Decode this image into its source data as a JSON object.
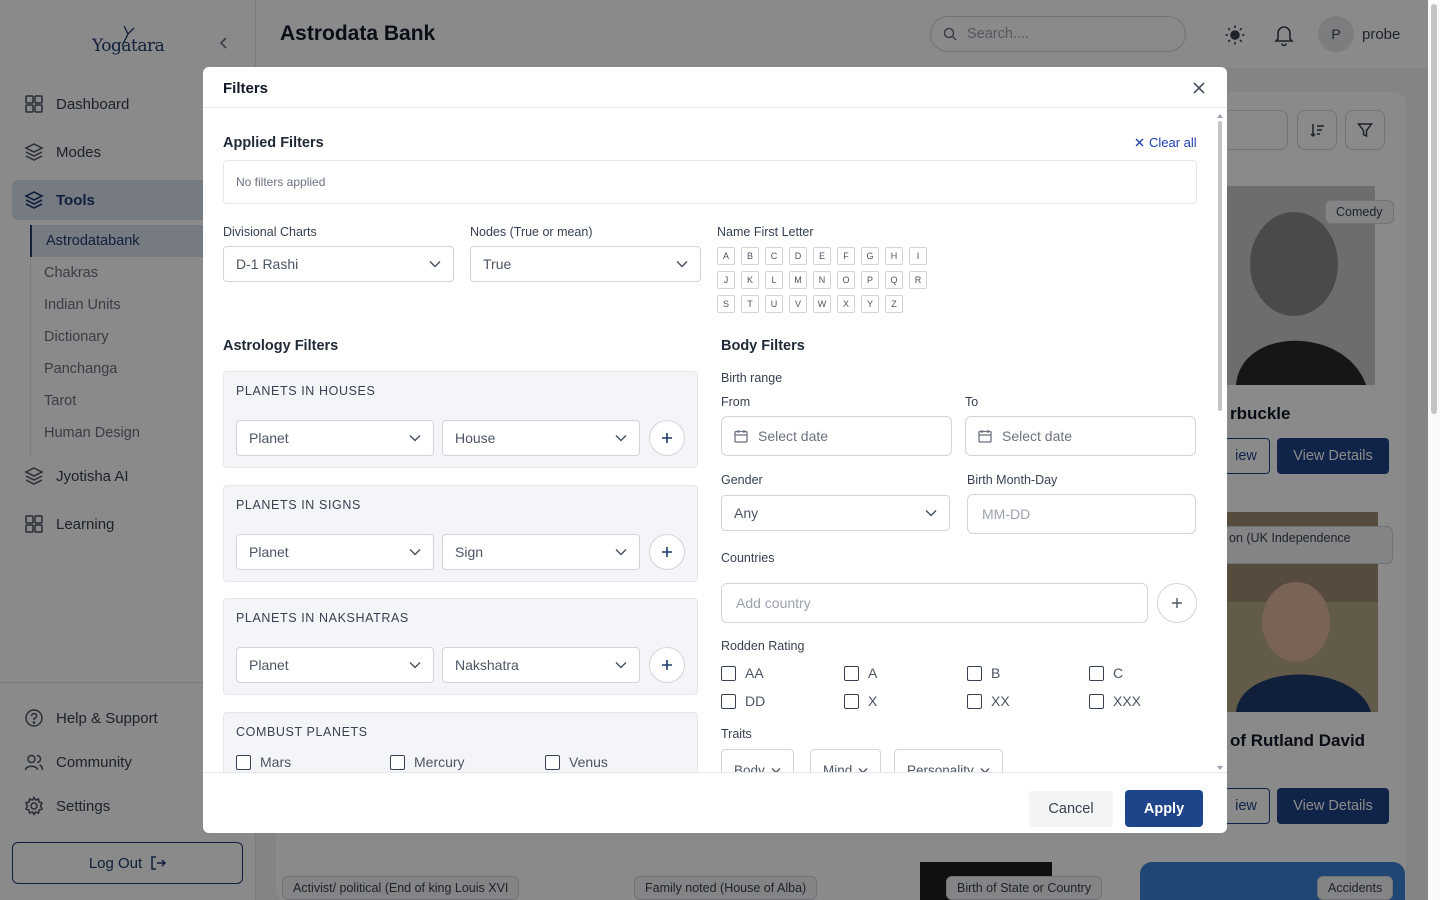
{
  "app": {
    "logo_text": "Yogatara",
    "title": "Astrodata Bank",
    "user_initial": "P",
    "username": "probe"
  },
  "search": {
    "placeholder": "Search...."
  },
  "sidebar": {
    "items": [
      {
        "label": "Dashboard",
        "icon": "grid-icon"
      },
      {
        "label": "Modes",
        "icon": "layers-icon"
      },
      {
        "label": "Tools",
        "icon": "layers-icon"
      },
      {
        "label": "Jyotisha AI",
        "icon": "layers-icon"
      },
      {
        "label": "Learning",
        "icon": "grid-icon"
      }
    ],
    "tools_sub": [
      "Astrodatabank",
      "Chakras",
      "Indian Units",
      "Dictionary",
      "Panchanga",
      "Tarot",
      "Human Design"
    ],
    "bottom": [
      {
        "label": "Help & Support",
        "icon": "help-icon"
      },
      {
        "label": "Community",
        "icon": "users-icon"
      },
      {
        "label": "Settings",
        "icon": "gear-icon"
      }
    ],
    "logout": "Log Out"
  },
  "background": {
    "tags": [
      "Comedy",
      "on (UK Independence",
      "Activist/ political (End of king Louis XVI",
      "Family noted (House of Alba)",
      "Birth of State or Country",
      "Accidents"
    ],
    "names": [
      "rbuckle",
      "of Rutland David"
    ],
    "view_label": "iew",
    "view_details": "View Details"
  },
  "modal": {
    "title": "Filters",
    "applied_title": "Applied Filters",
    "clear_all": "Clear all",
    "no_filters": "No filters applied",
    "divisional_label": "Divisional Charts",
    "divisional_value": "D-1 Rashi",
    "nodes_label": "Nodes (True or mean)",
    "nodes_value": "True",
    "letter_label": "Name First Letter",
    "letters": [
      "A",
      "B",
      "C",
      "D",
      "E",
      "F",
      "G",
      "H",
      "I",
      "J",
      "K",
      "L",
      "M",
      "N",
      "O",
      "P",
      "Q",
      "R",
      "S",
      "T",
      "U",
      "V",
      "W",
      "X",
      "Y",
      "Z"
    ],
    "astrology_title": "Astrology Filters",
    "cards": [
      {
        "title": "PLANETS IN HOUSES",
        "a": "Planet",
        "b": "House"
      },
      {
        "title": "PLANETS IN SIGNS",
        "a": "Planet",
        "b": "Sign"
      },
      {
        "title": "PLANETS IN NAKSHATRAS",
        "a": "Planet",
        "b": "Nakshatra"
      }
    ],
    "combust": {
      "title": "COMBUST PLANETS",
      "options": [
        "Mars",
        "Mercury",
        "Venus"
      ]
    },
    "body_title": "Body Filters",
    "birth_range": "Birth range",
    "from_label": "From",
    "to_label": "To",
    "date_placeholder": "Select date",
    "gender_label": "Gender",
    "gender_value": "Any",
    "monthday_label": "Birth Month-Day",
    "monthday_placeholder": "MM-DD",
    "countries_label": "Countries",
    "country_placeholder": "Add country",
    "rodden_label": "Rodden Rating",
    "rodden": [
      "AA",
      "A",
      "B",
      "C",
      "DD",
      "X",
      "XX",
      "XXX"
    ],
    "traits_label": "Traits",
    "traits": [
      "Body",
      "Mind",
      "Personality"
    ],
    "cancel": "Cancel",
    "apply": "Apply"
  },
  "colors": {
    "primary": "#1e4489",
    "accent_bg": "#dbe4f1"
  }
}
